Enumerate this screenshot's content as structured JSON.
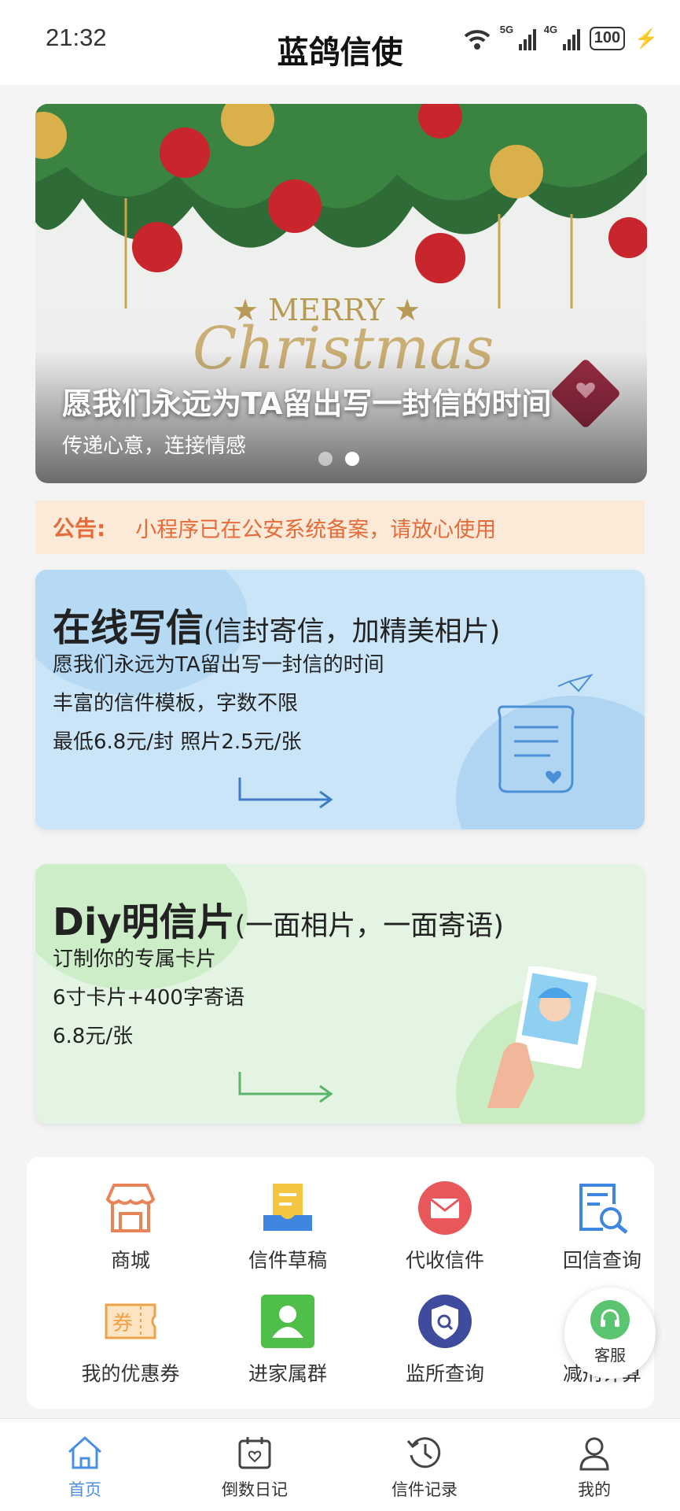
{
  "status_bar": {
    "time": "21:32",
    "network_1": "5G",
    "network_2": "4G",
    "battery": "100"
  },
  "header": {
    "title": "蓝鸽信使"
  },
  "banner": {
    "title": "愿我们永远为TA留出写一封信的时间",
    "subtitle": "传递心意，连接情感",
    "merry": "★ MERRY ★",
    "christmas": "Christmas",
    "dots": 2,
    "active_dot": 2
  },
  "notice": {
    "label": "公告:",
    "text": "小程序已在公安系统备案，请放心使用"
  },
  "cards": {
    "letter": {
      "title": "在线写信",
      "title_note": "(信封寄信，加精美相片)",
      "line1": "愿我们永远为TA留出写一封信的时间",
      "line2": "丰富的信件模板，字数不限",
      "line3": "最低6.8元/封 照片2.5元/张",
      "accent": "#4a8fe4"
    },
    "postcard": {
      "title": "Diy明信片",
      "title_note": "(一面相片，一面寄语)",
      "line1": "订制你的专属卡片",
      "line2": "6寸卡片+400字寄语",
      "line3": "6.8元/张",
      "accent": "#5bb56a"
    }
  },
  "menu": {
    "items": [
      {
        "label": "商城",
        "icon": "shop-icon"
      },
      {
        "label": "信件草稿",
        "icon": "draft-icon"
      },
      {
        "label": "代收信件",
        "icon": "mail-icon"
      },
      {
        "label": "回信查询",
        "icon": "reply-search-icon"
      },
      {
        "label": "我的优惠券",
        "icon": "coupon-icon"
      },
      {
        "label": "进家属群",
        "icon": "family-group-icon"
      },
      {
        "label": "监所查询",
        "icon": "prison-search-icon"
      },
      {
        "label": "减刑计算",
        "icon": "calculator-icon"
      }
    ]
  },
  "service": {
    "label": "客服",
    "icon": "headset-icon"
  },
  "tabbar": {
    "tabs": [
      {
        "label": "首页",
        "icon": "home-icon",
        "active": true
      },
      {
        "label": "倒数日记",
        "icon": "calendar-icon",
        "active": false
      },
      {
        "label": "信件记录",
        "icon": "history-icon",
        "active": false
      },
      {
        "label": "我的",
        "icon": "user-icon",
        "active": false
      }
    ]
  }
}
